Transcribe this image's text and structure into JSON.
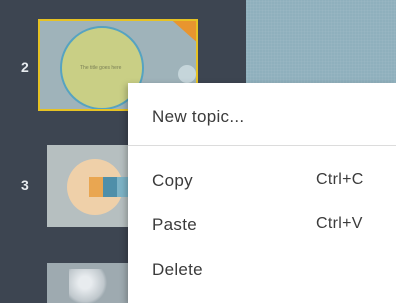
{
  "slide_panel": {
    "slides": [
      {
        "number": "2",
        "title_text": "The title goes here"
      },
      {
        "number": "3"
      }
    ]
  },
  "context_menu": {
    "items": [
      {
        "label": "New topic...",
        "shortcut": ""
      },
      {
        "label": "Copy",
        "shortcut": "Ctrl+C"
      },
      {
        "label": "Paste",
        "shortcut": "Ctrl+V"
      },
      {
        "label": "Delete",
        "shortcut": ""
      }
    ]
  },
  "colors": {
    "panel_background": "#3d4551",
    "selection_border": "#e6c224",
    "canvas_background": "#8fb0bd",
    "menu_background": "#ffffff",
    "menu_text": "#3b3b3b"
  }
}
